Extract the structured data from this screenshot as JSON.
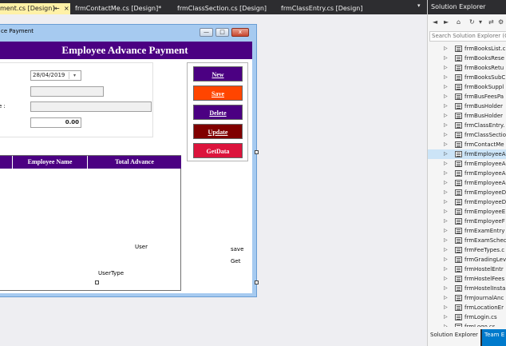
{
  "tabs": [
    {
      "label": "ment.cs [Design]",
      "active": true,
      "pin": "⇤",
      "close": "×"
    },
    {
      "label": "frmContactMe.cs [Design]*"
    },
    {
      "label": "frmClassSection.cs [Design]"
    },
    {
      "label": "frmClassEntry.cs [Design]"
    }
  ],
  "tab_menu": "▾",
  "form": {
    "title": "ce Payment",
    "min": "—",
    "max": "□",
    "close": "x",
    "header": "Employee Advance Payment",
    "date_value": "28/04/2019",
    "date_drop": "▾",
    "colon_label": "e :",
    "amount_value": "0.00",
    "buttons": {
      "new": "New",
      "save": "Save",
      "delete": "Delete",
      "update": "Update",
      "getdata": "GetData"
    },
    "grid_headers": [
      "Employee Name",
      "Total Advance"
    ],
    "labels": {
      "user": "User",
      "usertype": "UserType",
      "save": "save",
      "get": "Get"
    }
  },
  "colors": {
    "header": "#4b0082",
    "new": "#4b0082",
    "save": "#ff4500",
    "delete": "#4b0082",
    "update": "#800000",
    "getdata": "#dc143c"
  },
  "solution": {
    "title": "Solution Explorer",
    "toolbar": [
      "◄",
      "►",
      "⌂",
      "↻",
      "▾",
      "⇄",
      "⚙"
    ],
    "search_placeholder": "Search Solution Explorer (C",
    "items": [
      "frmBooksList.c",
      "frmBooksRese",
      "frmBooksRetu",
      "frmBooksSubC",
      "frmBookSuppl",
      "frmBusFeesPa",
      "frmBusHolder",
      "frmBusHolder",
      "frmClassEntry.",
      "frmClassSectio",
      "frmContactMe",
      "frmEmployeeA",
      "frmEmployeeA",
      "frmEmployeeA",
      "frmEmployeeA",
      "frmEmployeeD",
      "frmEmployeeD",
      "frmEmployeeE",
      "frmEmployeeF",
      "frmExamEntry",
      "frmExamSchec",
      "frmFeeTypes.c",
      "frmGradingLev",
      "frmHostelEntr",
      "frmHostelFees",
      "frmHostelInsta",
      "frmJournalAnc",
      "frmLocationEr",
      "frmLogin.cs",
      "frmLogo.cs"
    ],
    "selected_index": 11,
    "tabs": [
      "Solution Explorer",
      "Team E"
    ]
  }
}
